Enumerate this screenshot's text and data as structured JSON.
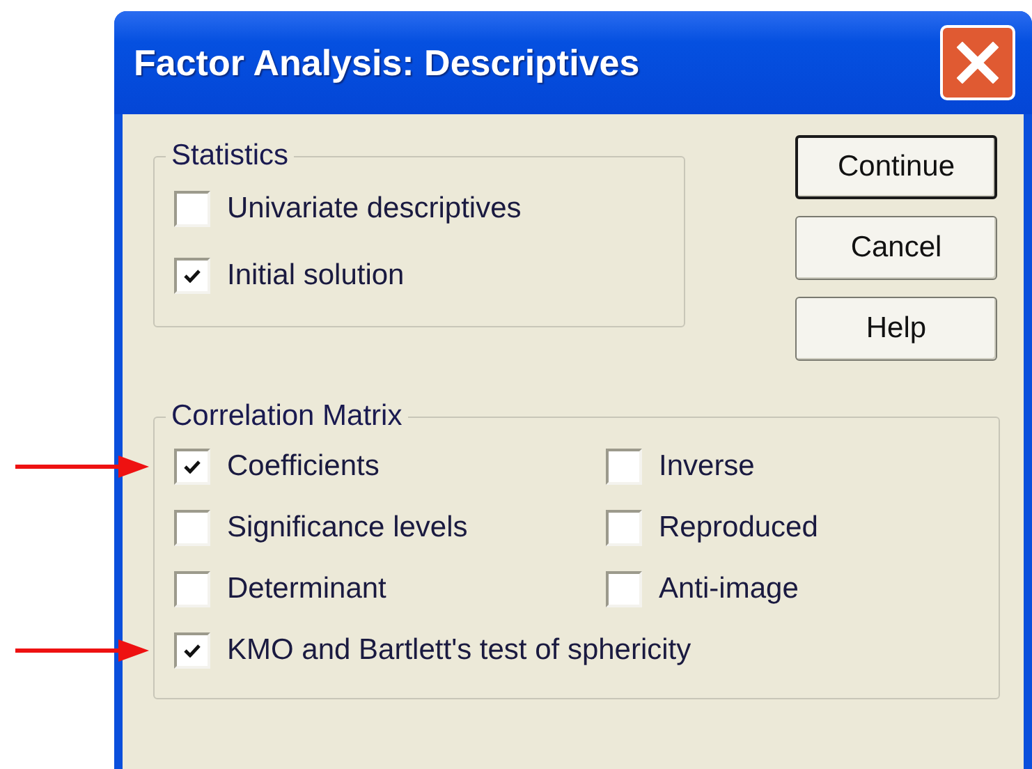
{
  "window": {
    "title": "Factor Analysis: Descriptives"
  },
  "statistics": {
    "title": "Statistics",
    "options": [
      {
        "label": "Univariate descriptives",
        "checked": false
      },
      {
        "label": "Initial solution",
        "checked": true
      }
    ]
  },
  "buttons": [
    {
      "label": "Continue",
      "default": true
    },
    {
      "label": "Cancel",
      "default": false
    },
    {
      "label": "Help",
      "default": false
    }
  ],
  "correlation_matrix": {
    "title": "Correlation Matrix",
    "rows": [
      {
        "arrow": true,
        "options": [
          {
            "label": "Coefficients",
            "checked": true
          },
          {
            "label": "Inverse",
            "checked": false
          }
        ]
      },
      {
        "arrow": false,
        "options": [
          {
            "label": "Significance levels",
            "checked": false
          },
          {
            "label": "Reproduced",
            "checked": false
          }
        ]
      },
      {
        "arrow": false,
        "options": [
          {
            "label": "Determinant",
            "checked": false
          },
          {
            "label": "Anti-image",
            "checked": false
          }
        ]
      },
      {
        "arrow": true,
        "options": [
          {
            "label": "KMO and Bartlett's test of sphericity",
            "checked": true
          }
        ]
      }
    ]
  }
}
